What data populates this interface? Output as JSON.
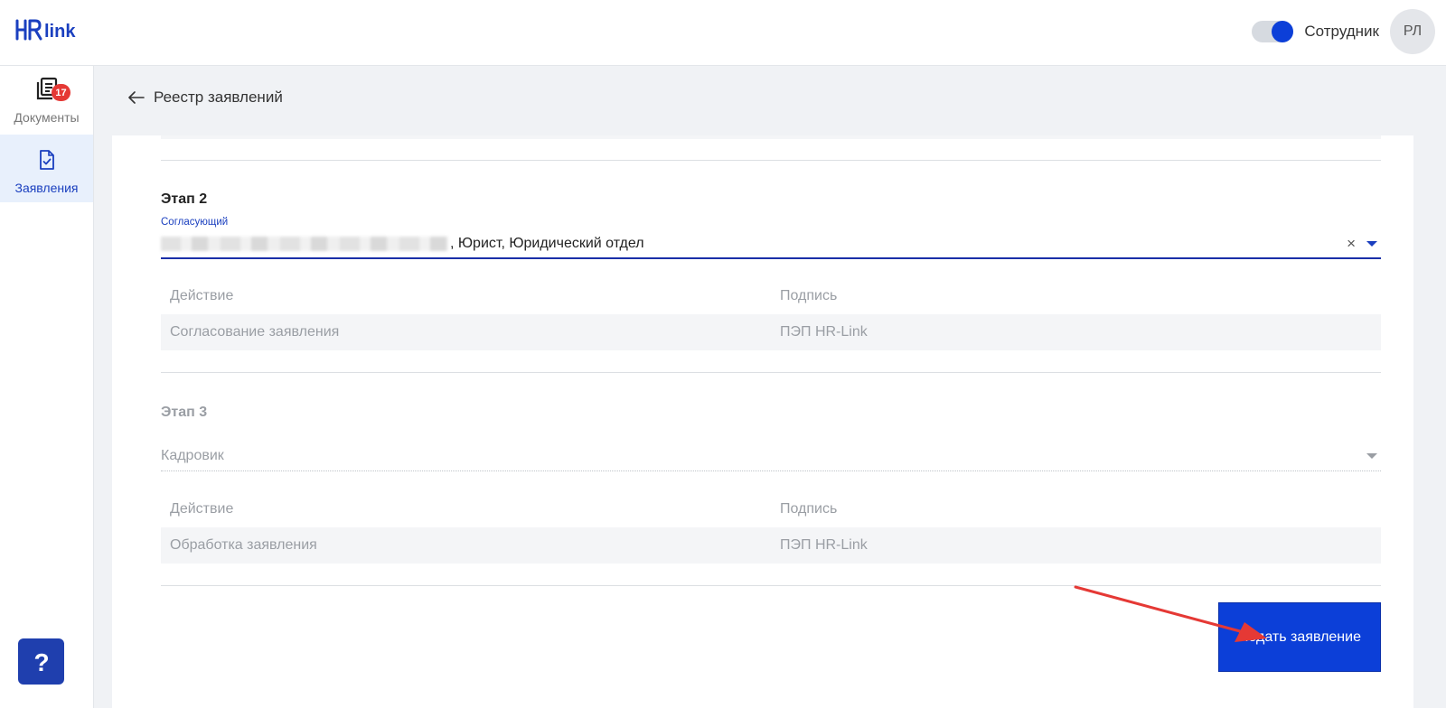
{
  "header": {
    "logo_text": "HRlink",
    "role_label": "Сотрудник",
    "role_toggle_on": true,
    "avatar_initials": "РЛ",
    "colors": {
      "accent": "#0c3fd8",
      "toggle_track": "#d6dae0"
    }
  },
  "sidebar": {
    "items": [
      {
        "label": "Документы",
        "icon": "documents-icon",
        "badge": "17",
        "active": false
      },
      {
        "label": "Заявления",
        "icon": "application-check-icon",
        "active": true
      }
    ],
    "help_icon": "question-icon",
    "colors": {
      "active_bg": "#e8f0fc",
      "badge": "#e53935",
      "help_bg": "#1f3fae"
    }
  },
  "breadcrumb": {
    "back_icon": "arrow-left-icon",
    "label": "Реестр заявлений"
  },
  "stages": [
    {
      "title": "Этап 2",
      "field_label": "Согласующий",
      "field_value_suffix": ", Юрист, Юридический отдел",
      "value_redacted": true,
      "table": {
        "headers": [
          "Действие",
          "Подпись"
        ],
        "rows": [
          [
            "Согласование заявления",
            "ПЭП HR-Link"
          ]
        ]
      }
    },
    {
      "title": "Этап 3",
      "field_placeholder": "Кадровик",
      "table": {
        "headers": [
          "Действие",
          "Подпись"
        ],
        "rows": [
          [
            "Обработка заявления",
            "ПЭП HR-Link"
          ]
        ]
      }
    }
  ],
  "submit_button": {
    "label": "Подать заявление"
  },
  "annotation": {
    "type": "red-arrow",
    "points_to": "submit_button",
    "color": "#e53935"
  }
}
